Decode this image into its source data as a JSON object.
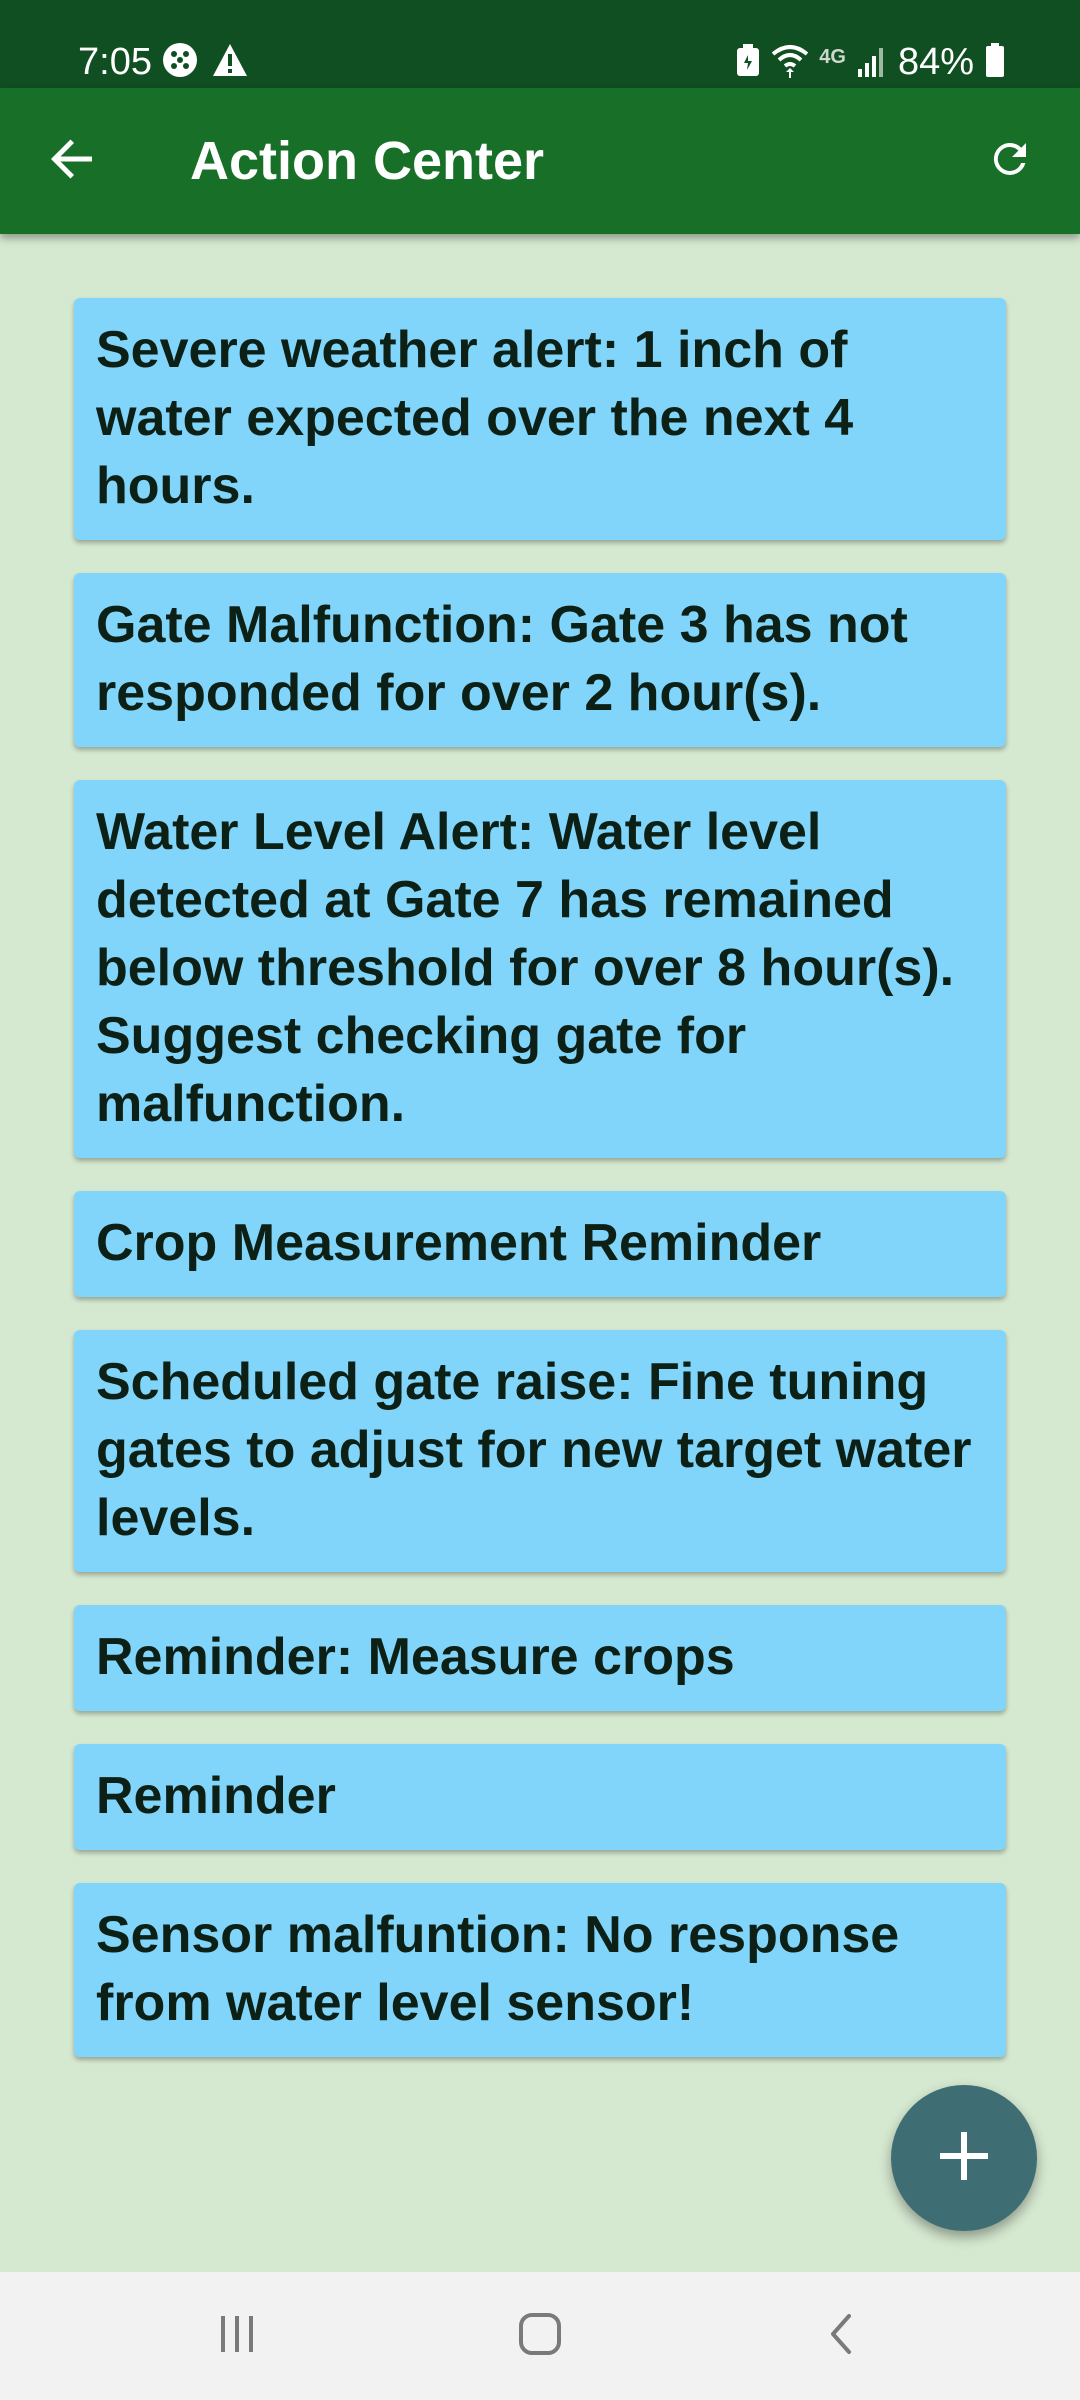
{
  "status_bar": {
    "time": "7:05",
    "battery_percent": "84%",
    "network_label": "4G",
    "icons": [
      "app-notification-icon",
      "warning-icon",
      "battery-saver-icon",
      "wifi-icon",
      "signal-icon",
      "battery-icon"
    ]
  },
  "app_bar": {
    "title": "Action Center",
    "back_icon": "arrow-back-icon",
    "refresh_icon": "refresh-icon"
  },
  "notifications": [
    {
      "text": "Severe weather alert: 1 inch of water expected over the next 4 hours."
    },
    {
      "text": "Gate Malfunction: Gate 3 has not responded for over 2 hour(s)."
    },
    {
      "text": "Water Level Alert: Water level detected at Gate 7 has remained below threshold for over 8 hour(s). Suggest checking gate for malfunction."
    },
    {
      "text": "Crop Measurement Reminder"
    },
    {
      "text": "Scheduled gate raise: Fine tuning gates to adjust for new target water levels."
    },
    {
      "text": "Reminder: Measure crops"
    },
    {
      "text": "Reminder"
    },
    {
      "text": "Sensor malfuntion: No response from water level sensor!"
    }
  ],
  "fab": {
    "icon": "plus-icon"
  },
  "nav_bar": {
    "icons": [
      "recent-apps-icon",
      "home-icon",
      "back-icon"
    ]
  },
  "colors": {
    "status_bar": "#0f4f21",
    "app_bar": "#187028",
    "background": "#d5e8d0",
    "card": "#81d4fa",
    "fab": "#3e6d73",
    "nav_bar": "#f2f2f2"
  }
}
